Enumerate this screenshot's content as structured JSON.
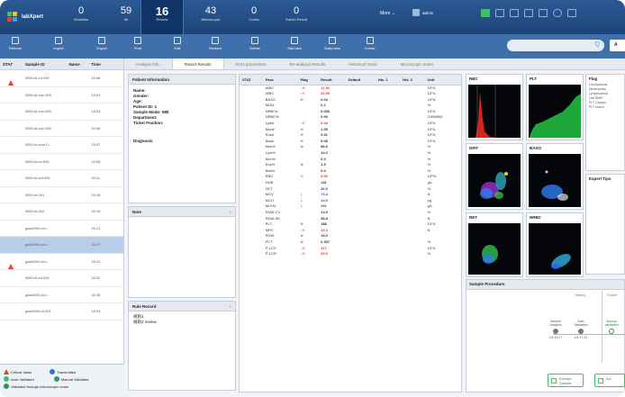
{
  "app": {
    "name": "labXpert"
  },
  "stats": [
    {
      "num": "0",
      "label": "Worklists"
    },
    {
      "num": "59",
      "label": "All"
    },
    {
      "num": "16",
      "label": "Review"
    },
    {
      "num": "43",
      "label": "Microscopic"
    },
    {
      "num": "0",
      "label": "Codes"
    },
    {
      "num": "0",
      "label": "Switch Result"
    }
  ],
  "header": {
    "more": "More",
    "more_caret": "⌄",
    "user": "admin"
  },
  "toolbar": {
    "refresh": "Refresh",
    "import": "Import",
    "export": "Export",
    "print": "Print",
    "edit": "Edit",
    "restore": "Restore",
    "delete": "Delete",
    "stat_labs": "Stat labs",
    "daily_labs": "Daily labs",
    "comm": "Comm."
  },
  "search": {
    "icon": "search-icon",
    "glyph": "Q",
    "button": "A"
  },
  "list": {
    "headers": {
      "stat": "STAT",
      "id": "Sample ID",
      "name": "Name",
      "time": "Time"
    },
    "rows": [
      {
        "id": "0000-bi-cd-000",
        "time": "15:08",
        "stat": true,
        "selected": false
      },
      {
        "id": "0000-bi-cdv-303",
        "time": "15:01",
        "stat": false,
        "selected": false
      },
      {
        "id": "0000-bi-cdv-000",
        "time": "15:03",
        "stat": false,
        "selected": false
      },
      {
        "id": "0000-bi-cdv-000",
        "time": "15:06",
        "stat": false,
        "selected": false
      },
      {
        "id": "0000-bi-cdvr-0..",
        "time": "15:07",
        "stat": false,
        "selected": false
      },
      {
        "id": "0000-bi-cv-000",
        "time": "15:08",
        "stat": false,
        "selected": false
      },
      {
        "id": "0000-bi-cdl-000",
        "time": "15:11",
        "stat": false,
        "selected": false
      },
      {
        "id": "0000-bl-001",
        "time": "15:18",
        "stat": false,
        "selected": false
      },
      {
        "id": "0000-bl-002",
        "time": "15:18",
        "stat": false,
        "selected": false
      },
      {
        "id": "goal0000-bl-c..",
        "time": "15:21",
        "stat": false,
        "selected": false
      },
      {
        "id": "goal0000-bl-c..",
        "time": "15:27",
        "stat": false,
        "selected": true
      },
      {
        "id": "goal0000-bl-c..",
        "time": "15:31",
        "stat": true,
        "selected": false
      },
      {
        "id": "0000-bl-cd-004",
        "time": "15:32",
        "stat": false,
        "selected": false
      },
      {
        "id": "goal0000-bl-c..",
        "time": "15:35",
        "stat": false,
        "selected": false
      },
      {
        "id": "goal0000-bl-001",
        "time": "16:03",
        "stat": false,
        "selected": false
      }
    ]
  },
  "legend": {
    "critical": "Critical Value",
    "transmitted": "Transmitted",
    "auto": "Auto Validated",
    "manual": "Manual Validated",
    "micro": "Validated through microscopic exam"
  },
  "tabs": [
    "Analysis Info.",
    "Report Results",
    "RUO parameters",
    "Re-analysis Results",
    "Historical Trend",
    "Microscopic Exam"
  ],
  "patient": {
    "title": "Patient Information",
    "name": "Name:",
    "gender": "Gender:",
    "age": "Age:",
    "patient_id": "Patient ID: 1",
    "sample_mode": "Sample Mode: WB",
    "department": "Department:",
    "ticket_position": "Ticket Position:",
    "diagnosis": "Diagnosis"
  },
  "note": {
    "title": "Note",
    "collapse": "≈"
  },
  "rule": {
    "title": "Rule Record",
    "collapse": "≈",
    "lines": [
      "规则1",
      "规则2 review"
    ]
  },
  "results": {
    "headers": [
      "STAT",
      "Para",
      "Flag",
      "Result",
      "Default",
      "His. 1",
      "His. 2",
      "Unit"
    ],
    "rows": [
      {
        "para": "WBC",
        "flag": "↓H",
        "result": "11.92",
        "unit": "10⁹/L",
        "color": "red"
      },
      {
        "para": "WBC",
        "flag": "↓H",
        "result": "20.99",
        "unit": "10⁹/L",
        "color": "red"
      },
      {
        "para": "BASO",
        "flag": "H",
        "result": "0.04",
        "unit": "10⁹/L",
        "color": ""
      },
      {
        "para": "MON",
        "flag": "",
        "result": "0.2",
        "unit": "%",
        "color": ""
      },
      {
        "para": "NRBC#",
        "flag": "",
        "result": "0.000",
        "unit": "10⁹/L",
        "color": ""
      },
      {
        "para": "NRBC%",
        "flag": "",
        "result": "0.00",
        "unit": "/100WBC",
        "color": ""
      },
      {
        "para": "Lym#",
        "flag": "↓H",
        "result": "0.04",
        "unit": "10⁹/L",
        "color": "red"
      },
      {
        "para": "Mon#",
        "flag": "H",
        "result": "1.09",
        "unit": "10⁹/L",
        "color": ""
      },
      {
        "para": "Eos#",
        "flag": "H",
        "result": "0.31",
        "unit": "10⁹/L",
        "color": ""
      },
      {
        "para": "Bas#",
        "flag": "H",
        "result": "0.08",
        "unit": "10⁹/L",
        "color": ""
      },
      {
        "para": "Neu%",
        "flag": "N",
        "result": "86.6",
        "unit": "%",
        "color": ""
      },
      {
        "para": "Lym%",
        "flag": "",
        "result": "10.2",
        "unit": "%",
        "color": ""
      },
      {
        "para": "Mon%",
        "flag": "",
        "result": "0.3",
        "unit": "%",
        "color": ""
      },
      {
        "para": "Eos%",
        "flag": "N",
        "result": "1.9",
        "unit": "%",
        "color": ""
      },
      {
        "para": "Bas%",
        "flag": "",
        "result": "0.4",
        "unit": "%",
        "color": ""
      },
      {
        "para": "RBC",
        "flag": "H",
        "result": "5.05",
        "unit": "10¹²/L",
        "color": "red"
      },
      {
        "para": "HGB",
        "flag": "",
        "result": "131",
        "unit": "g/L",
        "color": ""
      },
      {
        "para": "HCT",
        "flag": "",
        "result": "41.0",
        "unit": "%",
        "color": ""
      },
      {
        "para": "MCV",
        "flag": "L",
        "result": "74.4",
        "unit": "fL",
        "color": "blue"
      },
      {
        "para": "MCH",
        "flag": "L",
        "result": "24.0",
        "unit": "pg",
        "color": "blue"
      },
      {
        "para": "MCHC",
        "flag": "L",
        "result": "291",
        "unit": "g/L",
        "color": "blue"
      },
      {
        "para": "RDW-CV",
        "flag": "",
        "result": "14.9",
        "unit": "%",
        "color": ""
      },
      {
        "para": "RDW-SD",
        "flag": "",
        "result": "38.8",
        "unit": "fL",
        "color": ""
      },
      {
        "para": "PLT",
        "flag": "N",
        "result": "188",
        "unit": "10⁹/L",
        "color": ""
      },
      {
        "para": "MPV",
        "flag": "↓H",
        "result": "13.4",
        "unit": "fL",
        "color": "red"
      },
      {
        "para": "PDW",
        "flag": "N",
        "result": "15.0",
        "unit": "",
        "color": ""
      },
      {
        "para": "PCT",
        "flag": "N",
        "result": "0.307",
        "unit": "%",
        "color": ""
      },
      {
        "para": "P-LCC",
        "flag": "↓H",
        "result": "117",
        "unit": "10⁹/L",
        "color": "red"
      },
      {
        "para": "P-LCR",
        "flag": "↓H",
        "result": "60.0",
        "unit": "%",
        "color": "red"
      }
    ]
  },
  "graphs": {
    "rbc": "RBC",
    "plt": "PLT",
    "diff": "DIFF",
    "baso": "BASO",
    "ret": "RET",
    "nrbc": "NRBC"
  },
  "flag_panel": {
    "title": "Flag",
    "items": [
      "Leucocytosis",
      "Neutrophilia",
      "Lymphopenia",
      "Left Shift?",
      "PLT Clumps",
      "PLT macro"
    ]
  },
  "expert": {
    "title": "Expert Tips"
  },
  "procedure": {
    "title": "Sample Procedure",
    "history": "History",
    "future": "Future",
    "steps": [
      {
        "label": "Sample Analysis",
        "date": "1/6 15:27"
      },
      {
        "label": "Auto Validation",
        "date": "1/6 17:23"
      },
      {
        "label": "Manual Validation",
        "date": ""
      }
    ],
    "btn_exempt": "Exempt Sample",
    "btn_next": "Ad..."
  }
}
